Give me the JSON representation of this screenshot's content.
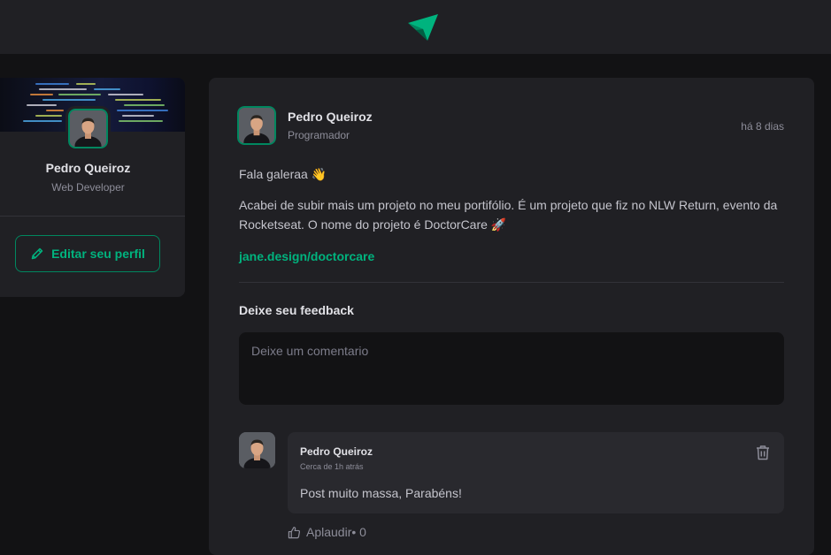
{
  "header": {
    "logo_icon": "ignite-feed-logo"
  },
  "sidebar": {
    "profile": {
      "name": "Pedro Queiroz",
      "role": "Web Developer"
    },
    "edit_button": {
      "label": "Editar seu perfil",
      "icon": "pencil-icon"
    }
  },
  "post": {
    "author": {
      "name": "Pedro Queiroz",
      "role": "Programador"
    },
    "published": "há 8 dias",
    "content": {
      "greeting": "Fala galeraa 👋",
      "body": "Acabei de subir mais um projeto no meu portifólio. É um projeto que fiz no NLW Return, evento da Rocketseat. O nome do projeto é DoctorCare 🚀",
      "link": "jane.design/doctorcare"
    },
    "feedback": {
      "title": "Deixe seu feedback",
      "placeholder": "Deixe um comentario"
    },
    "comments": [
      {
        "author": "Pedro Queiroz",
        "time": "Cerca de 1h atrás",
        "text": "Post muito massa, Parabéns!",
        "applaud_label": "Aplaudir",
        "applaud_count": "• 0"
      }
    ]
  },
  "colors": {
    "background": "#121214",
    "surface": "#202024",
    "comment_surface": "#29292e",
    "accent": "#00b37e",
    "accent_border": "#00875f",
    "text": "#e1e1e6",
    "muted": "#8d8d99"
  }
}
